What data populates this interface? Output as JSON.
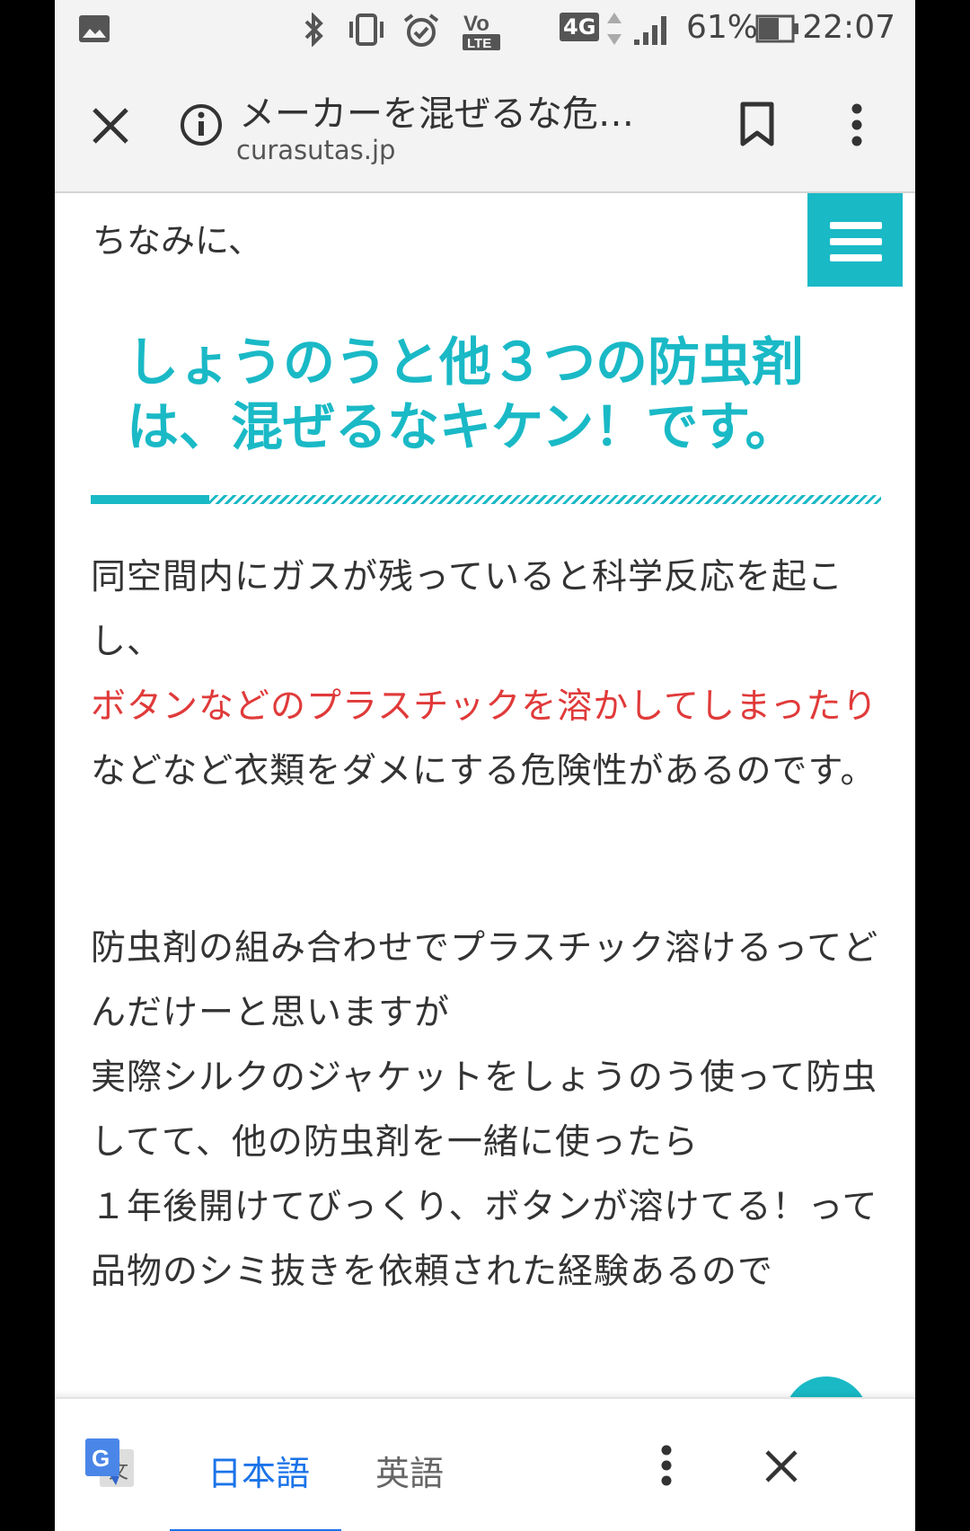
{
  "status_bar": {
    "network": "4G",
    "battery": "61%",
    "time": "22:07",
    "icons": [
      "image-icon",
      "bluetooth-icon",
      "vibrate-icon",
      "alarm-icon",
      "volte-icon",
      "signal-icon",
      "battery-icon"
    ]
  },
  "toolbar": {
    "title": "メーカーを混ぜるな危…",
    "domain": "curasutas.jp",
    "icons": [
      "close-icon",
      "info-icon",
      "bookmark-icon",
      "more-vert-icon"
    ]
  },
  "content": {
    "intro": "ちなみに、",
    "heading": "しょうのうと他３つの防虫剤は、混ぜるなキケン！です。",
    "para1_before": "同空間内にガスが残っていると科学反応を起こし、",
    "para1_red": "ボタンなどのプラスチックを溶かしてしまったり",
    "para1_after": "などなど衣類をダメにする危険性があるのです。",
    "para2_lines": [
      "防虫剤の組み合わせでプラスチック溶けるってどんだけーと思いますが",
      "実際シルクのジャケットをしょうのう使って防虫してて、他の防虫剤を一緒に使ったら",
      "１年後開けてびっくり、ボタンが溶けてる！って品物のシミ抜きを依頼された経験あるので"
    ],
    "accent_color": "#1ab9c6",
    "highlight_color": "#e03a3a"
  },
  "translate_bar": {
    "lang_source": "日本語",
    "lang_target": "英語",
    "active_color": "#1a73e8"
  }
}
